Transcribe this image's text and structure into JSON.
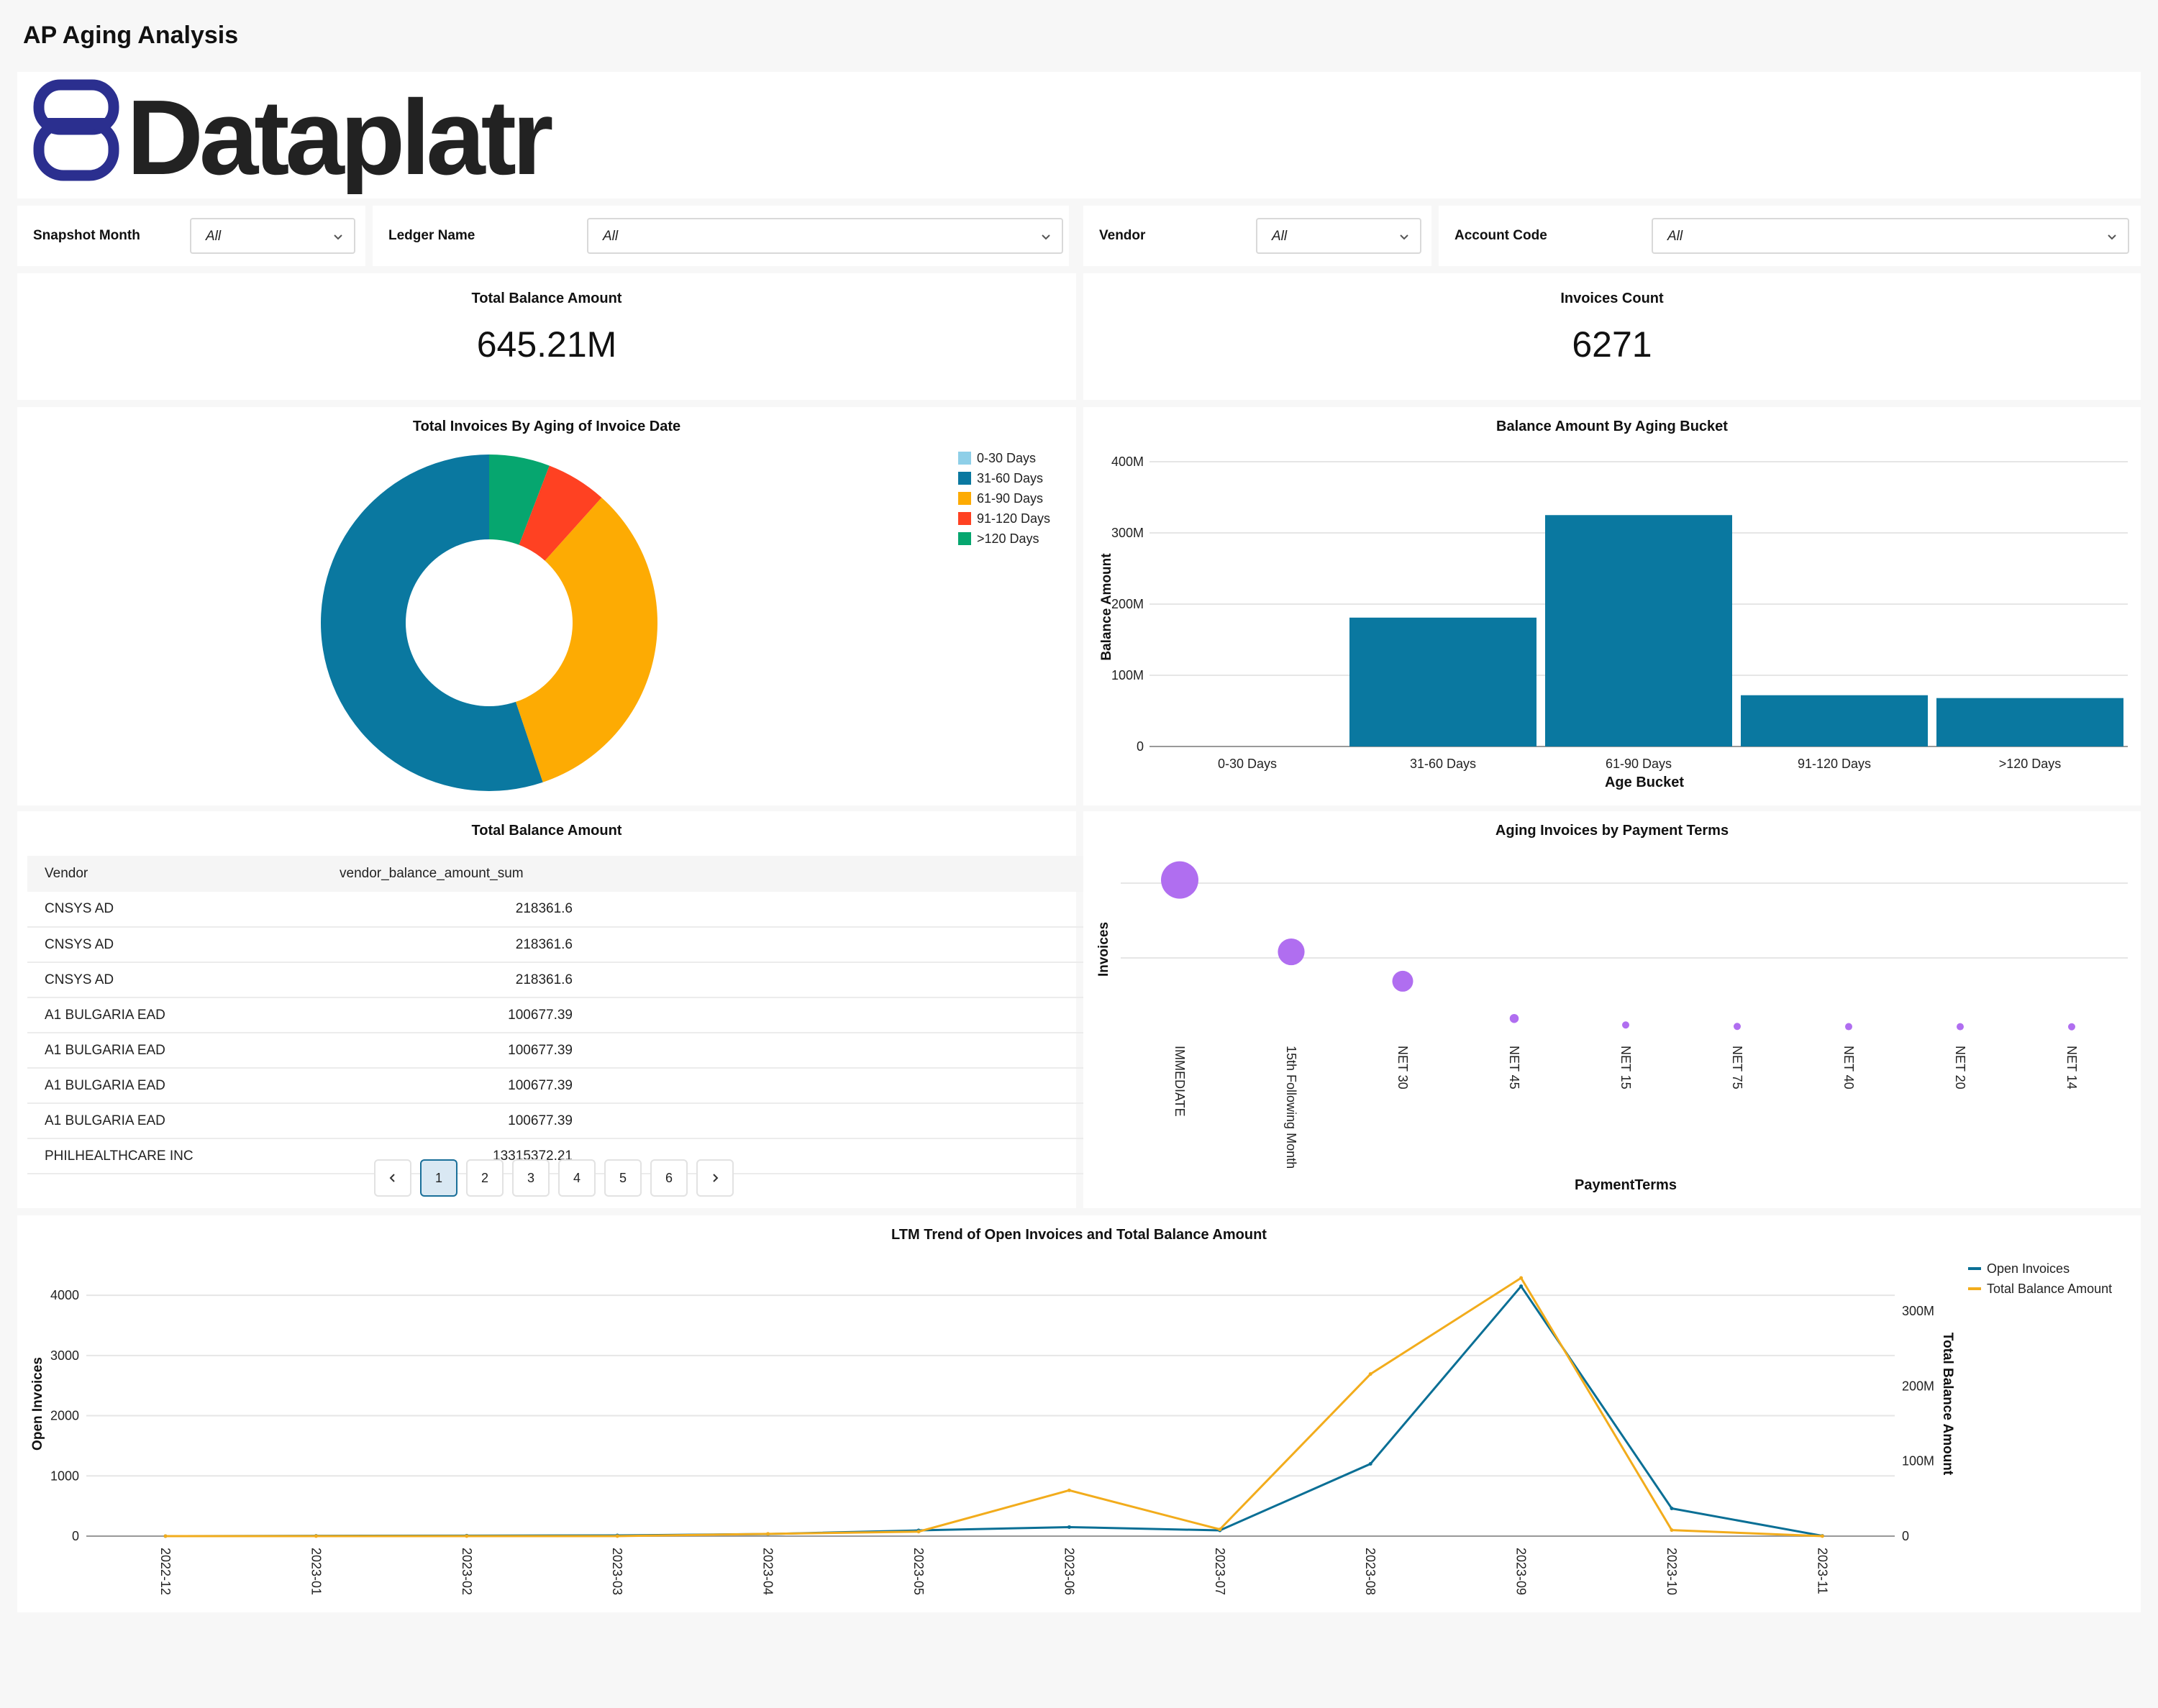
{
  "page": {
    "title": "AP Aging Analysis"
  },
  "logo": {
    "text": "Dataplatr"
  },
  "filters": [
    {
      "label": "Snapshot Month",
      "value": "All"
    },
    {
      "label": "Ledger Name",
      "value": "All"
    },
    {
      "label": "Vendor",
      "value": "All"
    },
    {
      "label": "Account Code",
      "value": "All"
    }
  ],
  "kpis": {
    "total_balance": {
      "title": "Total Balance Amount",
      "value": "645.21M"
    },
    "invoice_count": {
      "title": "Invoices Count",
      "value": "6271"
    }
  },
  "colors": {
    "teal": "#0a78a0",
    "orange": "#fdab03",
    "red": "#ff4122",
    "green": "#06a66f",
    "light_blue": "#8ecfe8",
    "purple": "#b06ef0"
  },
  "donut": {
    "chart_data": {
      "type": "pie",
      "title": "Total Invoices By Aging of Invoice Date",
      "categories": [
        "0-30 Days",
        "31-60 Days",
        "61-90 Days",
        "91-120 Days",
        ">120 Days"
      ],
      "values": [
        0,
        3564,
        2144,
        376,
        376
      ],
      "colors": [
        "#8ecfe8",
        "#0a78a0",
        "#fdab03",
        "#ff4122",
        "#06a66f"
      ],
      "legend_position": "top-right"
    }
  },
  "bar": {
    "chart_data": {
      "type": "bar",
      "title": "Balance Amount By Aging Bucket",
      "xlabel": "Age Bucket",
      "ylabel": "Balance Amount",
      "categories": [
        "0-30 Days",
        "31-60 Days",
        "61-90 Days",
        "91-120 Days",
        ">120 Days"
      ],
      "values": [
        0,
        181,
        325,
        72,
        68
      ],
      "yticks": [
        "0",
        "100M",
        "200M",
        "300M",
        "400M"
      ],
      "ylim": [
        0,
        400
      ],
      "grid": true
    }
  },
  "vendor_table": {
    "title": "Total Balance Amount",
    "columns": [
      "Vendor",
      "vendor_balance_amount_sum"
    ],
    "rows": [
      [
        "CNSYS AD",
        "218361.6"
      ],
      [
        "CNSYS AD",
        "218361.6"
      ],
      [
        "CNSYS AD",
        "218361.6"
      ],
      [
        "A1 BULGARIA EAD",
        "100677.39"
      ],
      [
        "A1 BULGARIA EAD",
        "100677.39"
      ],
      [
        "A1 BULGARIA EAD",
        "100677.39"
      ],
      [
        "A1 BULGARIA EAD",
        "100677.39"
      ],
      [
        "PHILHEALTHCARE INC",
        "13315372.21"
      ]
    ],
    "pagination": {
      "prev": "‹",
      "next": "›",
      "pages": [
        "1",
        "2",
        "3",
        "4",
        "5",
        "6"
      ],
      "current": "1"
    }
  },
  "bubble": {
    "chart_data": {
      "type": "scatter",
      "title": "Aging Invoices by Payment Terms",
      "xlabel": "PaymentTerms",
      "ylabel": "Invoices",
      "categories": [
        "IMMEDIATE",
        "15th Following Month",
        "NET 30",
        "NET 45",
        "NET 15",
        "NET 75",
        "NET 40",
        "NET 20",
        "NET 14"
      ],
      "values": [
        2250,
        1150,
        700,
        130,
        30,
        8,
        5,
        4,
        3
      ],
      "grid": true
    }
  },
  "trend": {
    "chart_data": {
      "type": "line",
      "title": "LTM Trend of Open Invoices and Total Balance Amount",
      "x": [
        "2022-12",
        "2023-01",
        "2023-02",
        "2023-03",
        "2023-04",
        "2023-05",
        "2023-06",
        "2023-07",
        "2023-08",
        "2023-09",
        "2023-10",
        "2023-11"
      ],
      "ylabel": "Open Invoices",
      "y2label": "Total Balance Amount",
      "yticks": [
        "0",
        "1000",
        "2000",
        "3000",
        "4000"
      ],
      "y2ticks": [
        "0",
        "100M",
        "200M",
        "300M"
      ],
      "ylim": [
        0,
        4300
      ],
      "y2lim": [
        0,
        345
      ],
      "series": [
        {
          "name": "Open Invoices",
          "axis": "left",
          "color": "#0a6f95",
          "values": [
            0,
            5,
            8,
            12,
            35,
            95,
            150,
            95,
            1200,
            4150,
            460,
            5
          ]
        },
        {
          "name": "Total Balance Amount",
          "axis": "right",
          "color": "#f2ac1c",
          "values": [
            0,
            0,
            0,
            0,
            3,
            6,
            61,
            9,
            216,
            344,
            8,
            0
          ]
        }
      ],
      "legend_position": "top-right",
      "grid": true
    }
  }
}
